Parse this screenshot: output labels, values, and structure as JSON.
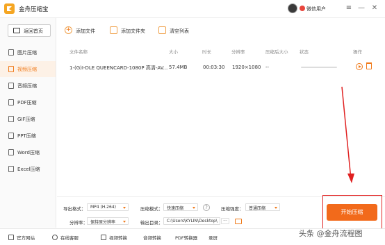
{
  "app": {
    "title": "金舟压缩宝"
  },
  "user": {
    "name": "微信用户"
  },
  "window_controls": {
    "menu": "≡",
    "minimize": "—",
    "close": "✕"
  },
  "sidebar": {
    "back_label": "返回首页",
    "items": [
      {
        "label": "图片压缩"
      },
      {
        "label": "视频压缩"
      },
      {
        "label": "音频压缩"
      },
      {
        "label": "PDF压缩"
      },
      {
        "label": "GIF压缩"
      },
      {
        "label": "PPT压缩"
      },
      {
        "label": "Word压缩"
      },
      {
        "label": "Excel压缩"
      }
    ]
  },
  "toolbar": {
    "add_file": "添加文件",
    "add_folder": "添加文件夹",
    "clear_list": "清空列表"
  },
  "table": {
    "columns": [
      "文件名称",
      "大小",
      "时长",
      "分辨率",
      "压缩后大小",
      "状态",
      "操作"
    ],
    "rows": [
      {
        "name": "1-(G)I-DLE QUEENCARD-1080P 高清-AV...",
        "size": "57.4MB",
        "duration": "00:03:30",
        "resolution": "1920×1080",
        "compressed_size": "--"
      }
    ]
  },
  "settings": {
    "output_format_label": "导出格式：",
    "output_format": "MP4 (H.264)",
    "compress_mode_label": "压缩模式：",
    "compress_mode": "快速压缩",
    "compress_strength_label": "压缩强度：",
    "compress_strength": "普通压缩",
    "resolution_label": "分辨率：",
    "resolution": "保持原分辨率",
    "output_dir_label": "输出目录：",
    "output_dir": "C:\\Users\\KYLIN\\Desktop\\",
    "more": "···"
  },
  "start_button": {
    "label": "开始压缩"
  },
  "footer": {
    "items": [
      {
        "label": "官方网站"
      },
      {
        "label": "在线客服"
      },
      {
        "label": "视频转换"
      },
      {
        "label": "音频转换"
      },
      {
        "label": "PDF转换器"
      },
      {
        "label": "录屏"
      }
    ]
  },
  "watermark": "头条 @金舟流程图",
  "colors": {
    "accent": "#f26a1b",
    "highlight": "#e02020"
  }
}
